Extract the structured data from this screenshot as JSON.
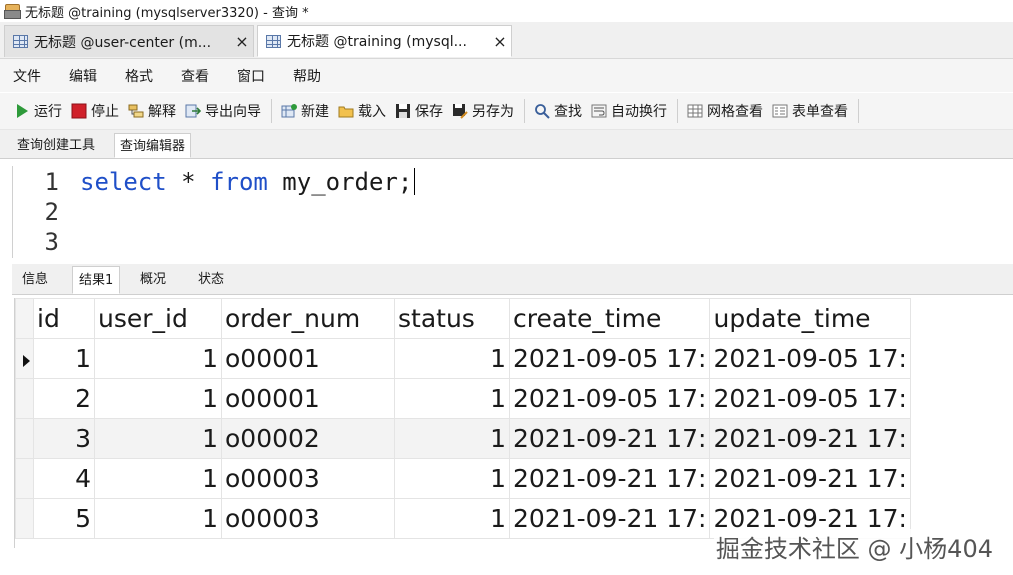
{
  "window": {
    "title": "无标题 @training (mysqlserver3320) - 查询 *"
  },
  "doc_tabs": [
    {
      "label": "无标题 @user-center (m...",
      "close": "×"
    },
    {
      "label": "无标题 @training (mysql...",
      "close": "×"
    }
  ],
  "menu": [
    "文件",
    "编辑",
    "格式",
    "查看",
    "窗口",
    "帮助"
  ],
  "toolbar": {
    "run": "运行",
    "stop": "停止",
    "explain": "解释",
    "export_wizard": "导出向导",
    "new": "新建",
    "load": "载入",
    "save": "保存",
    "save_as": "另存为",
    "find": "查找",
    "word_wrap": "自动换行",
    "grid_view": "网格查看",
    "form_view": "表单查看"
  },
  "sub_tabs": [
    "查询创建工具",
    "查询编辑器"
  ],
  "editor": {
    "line_numbers": [
      "1",
      "2",
      "3"
    ],
    "code": {
      "kw1": "select",
      "star": " * ",
      "kw2": "from",
      "rest": " my_order;"
    }
  },
  "result_tabs": [
    "信息",
    "结果1",
    "概况",
    "状态"
  ],
  "grid": {
    "columns": [
      "id",
      "user_id",
      "order_num",
      "status",
      "create_time",
      "update_time"
    ],
    "rows": [
      [
        "1",
        "1",
        "o00001",
        "1",
        "2021-09-05 17:",
        "2021-09-05 17:"
      ],
      [
        "2",
        "1",
        "o00001",
        "1",
        "2021-09-05 17:",
        "2021-09-05 17:"
      ],
      [
        "3",
        "1",
        "o00002",
        "1",
        "2021-09-21 17:",
        "2021-09-21 17:"
      ],
      [
        "4",
        "1",
        "o00003",
        "1",
        "2021-09-21 17:",
        "2021-09-21 17:"
      ],
      [
        "5",
        "1",
        "o00003",
        "1",
        "2021-09-21 17:",
        "2021-09-21 17:"
      ]
    ]
  },
  "watermark": "掘金技术社区 @ 小杨404"
}
